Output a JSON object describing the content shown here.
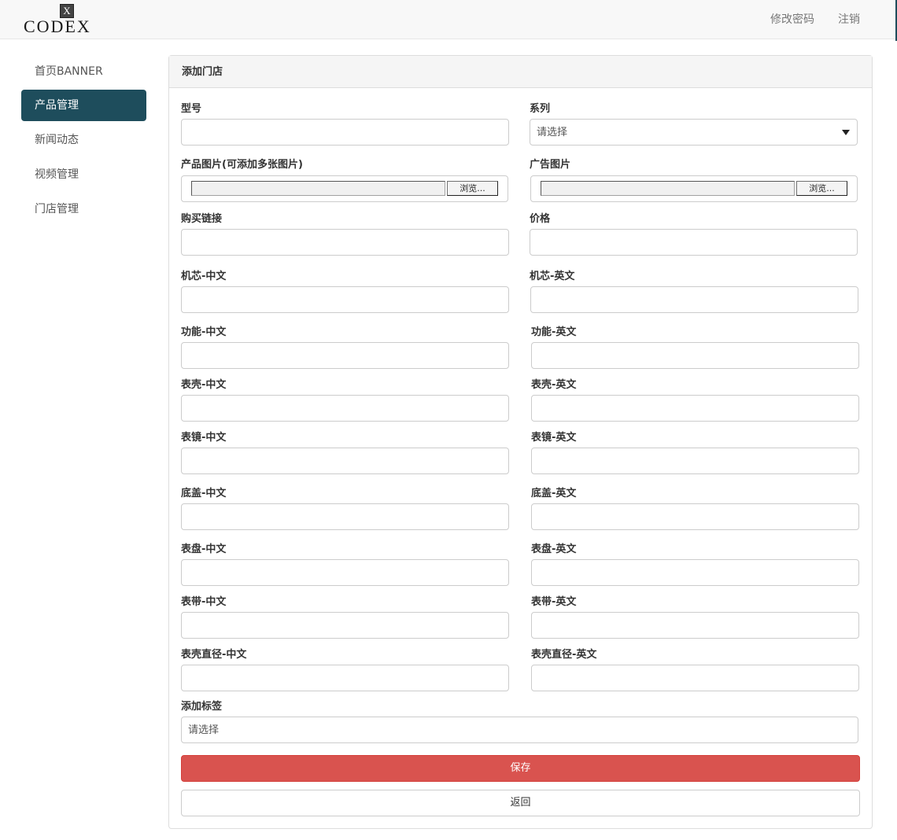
{
  "header": {
    "logo_mark": "X",
    "logo_text": "CODEX",
    "change_password": "修改密码",
    "logout": "注销"
  },
  "sidebar": {
    "items": [
      {
        "label": "首页BANNER",
        "active": false
      },
      {
        "label": "产品管理",
        "active": true
      },
      {
        "label": "新闻动态",
        "active": false
      },
      {
        "label": "视频管理",
        "active": false
      },
      {
        "label": "门店管理",
        "active": false
      }
    ]
  },
  "panel": {
    "title": "添加门店"
  },
  "form": {
    "model_label": "型号",
    "model_value": "",
    "series_label": "系列",
    "series_value": "请选择",
    "product_images_label": "产品图片(可添加多张图片)",
    "ad_image_label": "广告图片",
    "browse_label": "浏览...",
    "buy_link_label": "购买链接",
    "price_label": "价格",
    "movement_cn_label": "机芯-中文",
    "movement_en_label": "机芯-英文",
    "function_cn_label": "功能-中文",
    "function_en_label": "功能-英文",
    "case_cn_label": "表壳-中文",
    "case_en_label": "表壳-英文",
    "crystal_cn_label": "表镜-中文",
    "crystal_en_label": "表镜-英文",
    "caseback_cn_label": "底盖-中文",
    "caseback_en_label": "底盖-英文",
    "dial_cn_label": "表盘-中文",
    "dial_en_label": "表盘-英文",
    "strap_cn_label": "表带-中文",
    "strap_en_label": "表带-英文",
    "diameter_cn_label": "表壳直径-中文",
    "diameter_en_label": "表壳直径-英文",
    "tags_label": "添加标签",
    "tags_value": "请选择",
    "save_label": "保存",
    "back_label": "返回"
  },
  "colors": {
    "accent": "#1e4d5c",
    "danger": "#d9534f"
  }
}
